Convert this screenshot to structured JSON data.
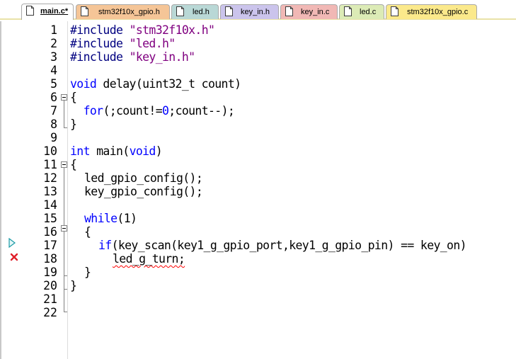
{
  "tabs": [
    {
      "label": "main.c*",
      "active": true
    },
    {
      "label": "stm32f10x_gpio.h",
      "active": false
    },
    {
      "label": "led.h",
      "active": false
    },
    {
      "label": "key_in.h",
      "active": false
    },
    {
      "label": "key_in.c",
      "active": false
    },
    {
      "label": "led.c",
      "active": false
    },
    {
      "label": "stm32f10x_gpio.c",
      "active": false
    }
  ],
  "colors": {
    "tab_active": "#ffffff",
    "tab_gpio_h": "#f5c597",
    "tab_led_h": "#b9d8d6",
    "tab_key_in_h": "#cbc4ec",
    "tab_key_in_c": "#f1b8b5",
    "tab_led_c": "#dcebb6",
    "tab_gpio_c": "#fbe98b",
    "keyword": "#0000ff",
    "string": "#800080",
    "error_squiggle": "#ff0000"
  },
  "editor": {
    "line_numbers": [
      "1",
      "2",
      "3",
      "4",
      "5",
      "6",
      "7",
      "8",
      "9",
      "10",
      "11",
      "12",
      "13",
      "14",
      "15",
      "16",
      "17",
      "18",
      "19",
      "20",
      "21",
      "22"
    ],
    "tokens": {
      "l1_kw": "#include",
      "l1_str": "\"stm32f10x.h\"",
      "l2_kw": "#include",
      "l2_str": "\"led.h\"",
      "l3_kw": "#include",
      "l3_str": "\"key_in.h\"",
      "l5_kw": "void",
      "l5_rest": " delay(uint32_t count)",
      "l6": "{",
      "l7_kw": "for",
      "l7_rest": "(;count!=",
      "l7_zero": "0",
      "l7_end": ";count--);",
      "l8": "}",
      "l10_kw": "int",
      "l10_mid": " main(",
      "l10_kw2": "void",
      "l10_end": ")",
      "l11": "{",
      "l12": "led_gpio_config();",
      "l13": "key_gpio_config();",
      "l15_kw": "while",
      "l15_rest": "(1)",
      "l16": "{",
      "l17_kw": "if",
      "l17_rest": "(key_scan(key1_g_gpio_port,key1_g_gpio_pin) == key_on)",
      "l18": "led_g_turn;",
      "l19": "}",
      "l20": "}"
    }
  },
  "gutter_markers": {
    "current_line_icon": "bookmark-arrow-icon",
    "error_icon": "error-x-icon"
  }
}
